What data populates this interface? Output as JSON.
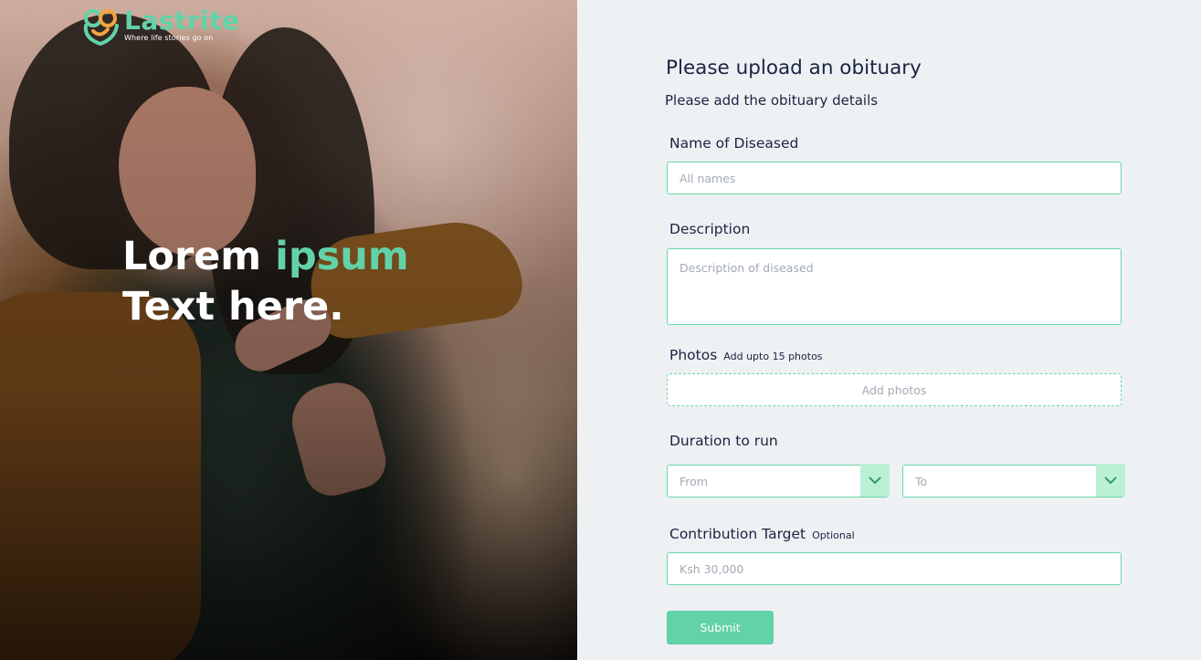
{
  "brand": {
    "name": "Lastrite",
    "tagline": "Where life stories go on",
    "accent_color": "#62d2a8"
  },
  "hero": {
    "line1_plain": "Lorem ",
    "line1_accent": "ipsum",
    "line2": "Text here."
  },
  "form": {
    "title": "Please upload an obituary",
    "subtitle": "Please add the obituary details",
    "name": {
      "label": "Name of Diseased",
      "placeholder": "All names"
    },
    "description": {
      "label": "Description",
      "placeholder": "Description of diseased"
    },
    "photos": {
      "label": "Photos",
      "hint": "Add upto 15 photos",
      "button": "Add photos"
    },
    "duration": {
      "label": "Duration to run",
      "from": "From",
      "to": "To",
      "icon": "chevron-down-icon"
    },
    "contribution": {
      "label": "Contribution Target",
      "hint": "Optional",
      "placeholder": "Ksh 30,000"
    },
    "submit": "Submit"
  }
}
